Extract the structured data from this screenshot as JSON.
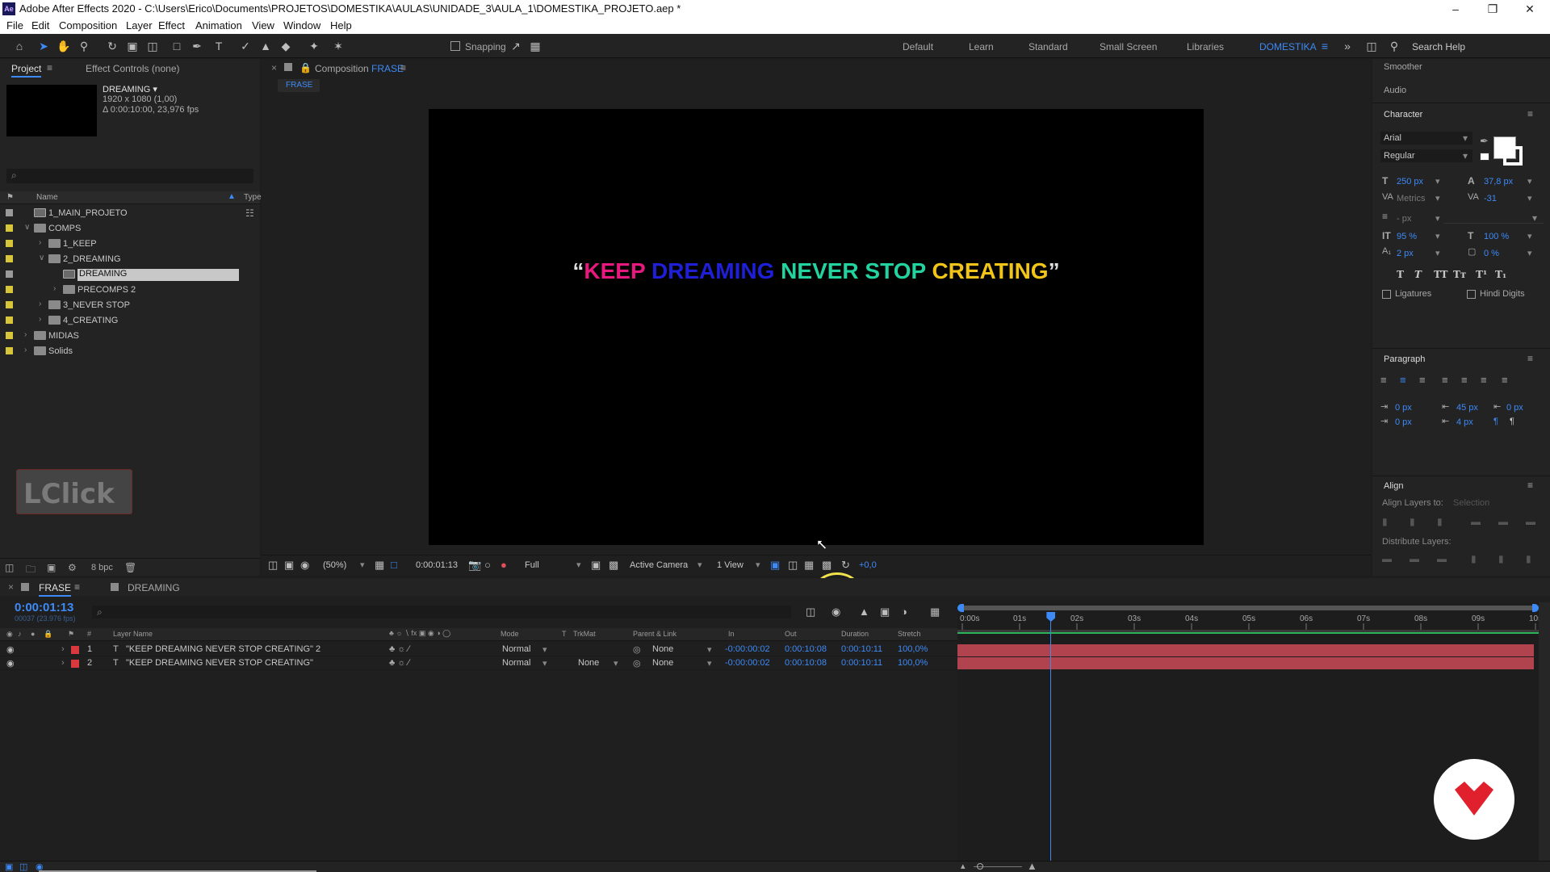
{
  "app": {
    "title": "Adobe After Effects 2020 - C:\\Users\\Erico\\Documents\\PROJETOS\\DOMESTIKA\\AULAS\\UNIDADE_3\\AULA_1\\DOMESTIKA_PROJETO.aep *",
    "logo_text": "Ae"
  },
  "menu": [
    "File",
    "Edit",
    "Composition",
    "Layer",
    "Effect",
    "Animation",
    "View",
    "Window",
    "Help"
  ],
  "toolbar": {
    "snapping_label": "Snapping",
    "workspaces": [
      "Default",
      "Learn",
      "Standard",
      "Small Screen",
      "Libraries",
      "DOMESTIKA"
    ],
    "active_workspace": "DOMESTIKA",
    "search_placeholder": "Search Help"
  },
  "project_panel": {
    "tab_project": "Project",
    "tab_effect_controls": "Effect Controls (none)",
    "selected_item": {
      "name": "DREAMING ▾",
      "size": "1920 x 1080 (1,00)",
      "duration": "Δ 0:00:10:00, 23,976 fps"
    },
    "search_placeholder": "⌕",
    "col_name": "Name",
    "col_type": "Type",
    "items": [
      {
        "label": "1_MAIN_PROJETO",
        "indent": 0,
        "kind": "comp",
        "twirl": ""
      },
      {
        "label": "COMPS",
        "indent": 0,
        "kind": "folder",
        "twirl": "∨"
      },
      {
        "label": "1_KEEP",
        "indent": 1,
        "kind": "folder",
        "twirl": "›"
      },
      {
        "label": "2_DREAMING",
        "indent": 1,
        "kind": "folder",
        "twirl": "∨"
      },
      {
        "label": "DREAMING",
        "indent": 2,
        "kind": "comp",
        "twirl": "",
        "selected": true
      },
      {
        "label": "PRECOMPS 2",
        "indent": 2,
        "kind": "folder",
        "twirl": "›"
      },
      {
        "label": "3_NEVER STOP",
        "indent": 1,
        "kind": "folder",
        "twirl": "›"
      },
      {
        "label": "4_CREATING",
        "indent": 1,
        "kind": "folder",
        "twirl": "›"
      },
      {
        "label": "MIDIAS",
        "indent": 0,
        "kind": "folder",
        "twirl": "›"
      },
      {
        "label": "Solids",
        "indent": 0,
        "kind": "folder",
        "twirl": "›"
      }
    ],
    "bpc_label": "8 bpc",
    "lclick_label": "LClick"
  },
  "composition": {
    "tab_prefix": "Composition",
    "tab_name": "FRASE",
    "breadcrumb": "FRASE",
    "text": {
      "open_quote": "“",
      "w1": "KEEP",
      "w2": "DREAMING",
      "w3": "NEVER STOP",
      "w4": "CREATING",
      "close_quote": "”"
    },
    "colors": {
      "keep": "#e8197e",
      "dreaming": "#1f1fd8",
      "never_stop": "#22d3a0",
      "creating": "#f0c419"
    },
    "zoom": "(50%)",
    "timecode": "0:00:01:13",
    "resolution": "Full",
    "camera": "Active Camera",
    "view": "1 View",
    "exposure": "+0,0"
  },
  "right_panel": {
    "smoother": "Smoother",
    "audio": "Audio",
    "character": {
      "title": "Character",
      "font": "Arial",
      "style": "Regular",
      "size": "250 px",
      "leading": "37,8 px",
      "kerning": "Metrics",
      "tracking": "-31",
      "stroke": "- px",
      "vscale": "95 %",
      "hscale": "100 %",
      "baseline": "2 px",
      "tsume": "0 %",
      "ligatures": "Ligatures",
      "hindi_digits": "Hindi Digits"
    },
    "paragraph": {
      "title": "Paragraph",
      "indent_left": "0 px",
      "space_before": "45 px",
      "indent_right": "0 px",
      "indent_first": "0 px",
      "space_after": "4 px"
    },
    "align": {
      "title": "Align",
      "align_to_label": "Align Layers to:",
      "align_to_value": "Selection",
      "distribute": "Distribute Layers:"
    }
  },
  "timeline": {
    "tab_frase": "FRASE",
    "tab_dreaming": "DREAMING",
    "timecode": "0:00:01:13",
    "frames": "00037 (23.976 fps)",
    "search_placeholder": "⌕",
    "headers": {
      "layer_name": "Layer Name",
      "mode": "Mode",
      "t": "T",
      "trkmat": "TrkMat",
      "parent": "Parent & Link",
      "in": "In",
      "out": "Out",
      "duration": "Duration",
      "stretch": "Stretch"
    },
    "layers": [
      {
        "num": "1",
        "name": "\"KEEP DREAMING NEVER STOP CREATING\" 2",
        "mode": "Normal",
        "trkmat": "",
        "parent": "None",
        "in": "-0:00:00:02",
        "out": "0:00:10:08",
        "duration": "0:00:10:11",
        "stretch": "100,0%"
      },
      {
        "num": "2",
        "name": "\"KEEP DREAMING NEVER STOP CREATING\"",
        "mode": "Normal",
        "trkmat": "None",
        "parent": "None",
        "in": "-0:00:00:02",
        "out": "0:00:10:08",
        "duration": "0:00:10:11",
        "stretch": "100,0%"
      }
    ],
    "ruler": [
      "0:00s",
      "01s",
      "02s",
      "03s",
      "04s",
      "05s",
      "06s",
      "07s",
      "08s",
      "09s",
      "10s"
    ],
    "playhead_seconds": 1.54,
    "duration_seconds": 10
  }
}
